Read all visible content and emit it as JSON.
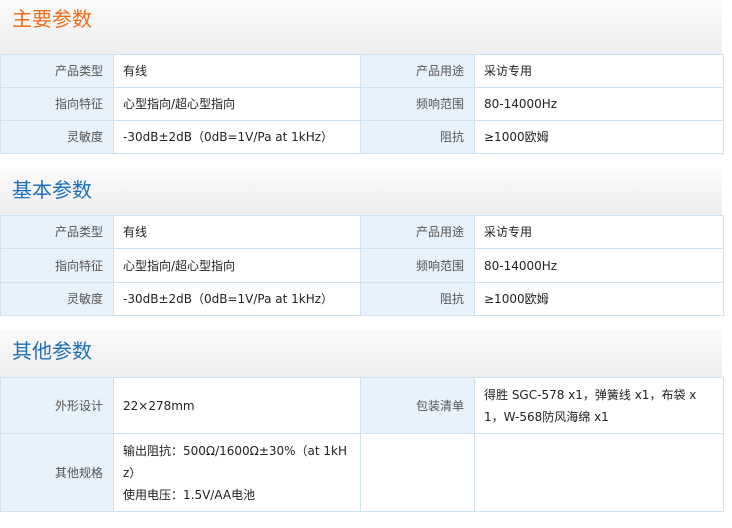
{
  "sections": [
    {
      "title": "主要参数",
      "title_color": "#ee6e1b",
      "rows": [
        {
          "l1": "产品类型",
          "v1": "有线",
          "l2": "产品用途",
          "v2": "采访专用"
        },
        {
          "l1": "指向特征",
          "v1": "心型指向/超心型指向",
          "l2": "频响范围",
          "v2": "80-14000Hz"
        },
        {
          "l1": "灵敏度",
          "v1": "-30dB±2dB（0dB=1V/Pa at 1kHz）",
          "l2": "阻抗",
          "v2": "≥1000欧姆"
        }
      ]
    },
    {
      "title": "基本参数",
      "title_color": "#1f6fb8",
      "rows": [
        {
          "l1": "产品类型",
          "v1": "有线",
          "l2": "产品用途",
          "v2": "采访专用"
        },
        {
          "l1": "指向特征",
          "v1": "心型指向/超心型指向",
          "l2": "频响范围",
          "v2": "80-14000Hz"
        },
        {
          "l1": "灵敏度",
          "v1": "-30dB±2dB（0dB=1V/Pa at 1kHz）",
          "l2": "阻抗",
          "v2": "≥1000欧姆"
        }
      ]
    },
    {
      "title": "其他参数",
      "title_color": "#1f6fb8",
      "rows": [
        {
          "l1": "外形设计",
          "v1": "22×278mm",
          "l2": "包装清单",
          "v2": "得胜 SGC-578 x1，弹簧线 x1，布袋 x1，W-568防风海绵 x1"
        },
        {
          "l1": "其他规格",
          "v1a": "输出阻抗：500Ω/1600Ω±30%（at 1kHz）",
          "v1b": "使用电压：1.5V/AA电池",
          "l2": "",
          "v2": ""
        }
      ]
    }
  ]
}
